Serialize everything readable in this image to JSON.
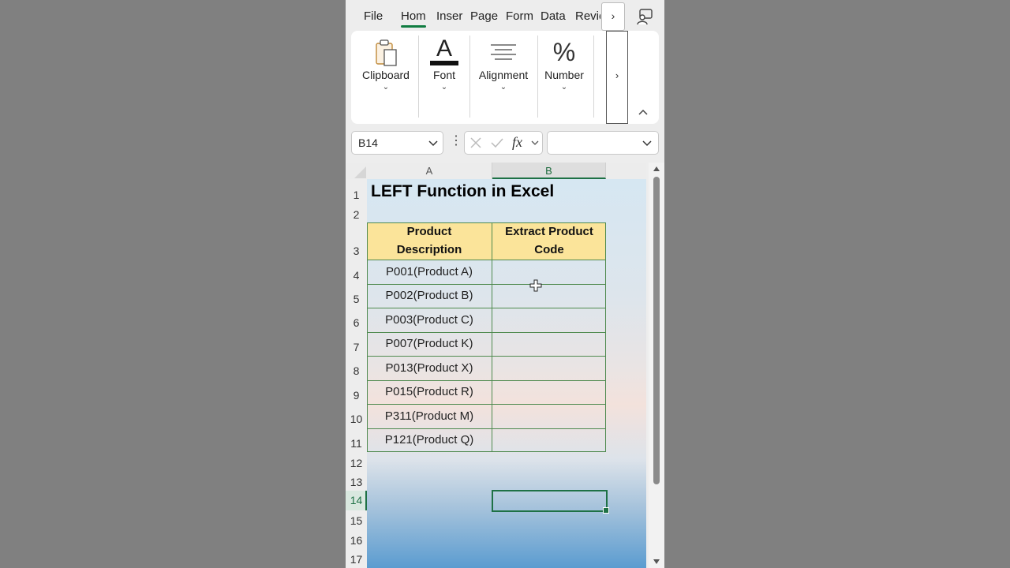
{
  "tabs": {
    "items": [
      "File",
      "Hom",
      "Inser",
      "Page",
      "Form",
      "Data",
      "Revie"
    ],
    "active": "Hom",
    "more": "›"
  },
  "ribbon": {
    "groups": [
      {
        "label": "Clipboard",
        "icon": "clipboard-icon"
      },
      {
        "label": "Font",
        "icon": "font-color-icon"
      },
      {
        "label": "Alignment",
        "icon": "align-center-icon"
      },
      {
        "label": "Number",
        "icon": "percent-icon"
      }
    ],
    "chevron": "⌄",
    "font_icon_glyph": "A",
    "number_icon_glyph": "%",
    "more": "›"
  },
  "formula_bar": {
    "name_box": "B14",
    "fx": "fx",
    "formula": ""
  },
  "columns": [
    "A",
    "B"
  ],
  "selected_column": "B",
  "rows": [
    "1",
    "2",
    "3",
    "4",
    "5",
    "6",
    "7",
    "8",
    "9",
    "10",
    "11",
    "12",
    "13",
    "14",
    "15",
    "16",
    "17"
  ],
  "selected_row": "14",
  "sheet": {
    "title": "LEFT Function in Excel",
    "table": {
      "headers": [
        "Product\nDescription",
        "Extract Product\nCode"
      ],
      "header_lines": [
        [
          "Product",
          "Description"
        ],
        [
          "Extract Product",
          "Code"
        ]
      ],
      "rows": [
        [
          "P001(Product A)",
          ""
        ],
        [
          "P002(Product B)",
          ""
        ],
        [
          "P003(Product C)",
          ""
        ],
        [
          "P007(Product K)",
          ""
        ],
        [
          "P013(Product X)",
          ""
        ],
        [
          "P015(Product R)",
          ""
        ],
        [
          "P311(Product M)",
          ""
        ],
        [
          "P121(Product Q)",
          ""
        ]
      ]
    }
  },
  "colors": {
    "accent": "#107c41",
    "header_fill": "#fbe49a",
    "table_border": "#4f8a4f"
  }
}
